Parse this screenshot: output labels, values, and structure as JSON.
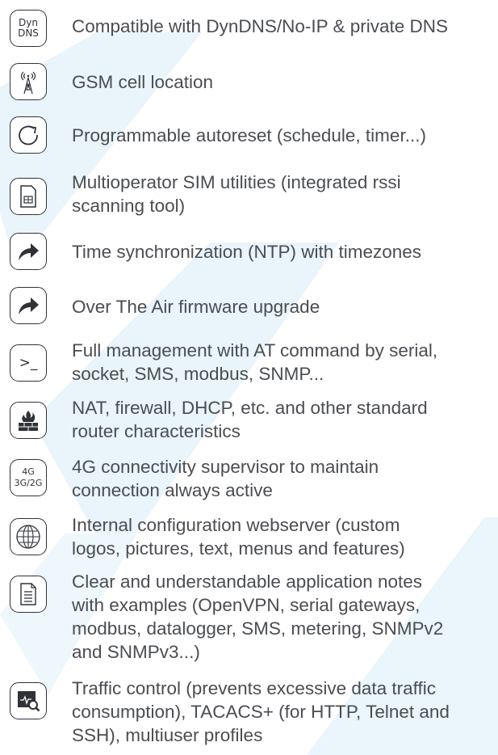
{
  "features": [
    {
      "icon": "dyndns-icon",
      "icon_text": "Dyn\nDNS",
      "text": "Compatible with DynDNS/No-IP & private DNS"
    },
    {
      "icon": "antenna-icon",
      "text": "GSM cell location"
    },
    {
      "icon": "refresh-icon",
      "text": "Programmable autoreset (schedule, timer...)"
    },
    {
      "icon": "sim-card-icon",
      "text": "Multioperator SIM utilities (integrated rssi\nscanning tool)"
    },
    {
      "icon": "share-arrow-icon",
      "text": "Time synchronization (NTP) with timezones"
    },
    {
      "icon": "share-arrow-icon",
      "text": "Over The Air firmware upgrade"
    },
    {
      "icon": "terminal-icon",
      "icon_text": ">_",
      "text": "Full management with AT command by serial,\nsocket, SMS, modbus, SNMP..."
    },
    {
      "icon": "firewall-icon",
      "text": "NAT, firewall, DHCP, etc. and other standard\nrouter characteristics"
    },
    {
      "icon": "network-generation-icon",
      "icon_text": "4G\n3G/2G",
      "text": "4G connectivity supervisor to maintain\nconnection always active"
    },
    {
      "icon": "globe-icon",
      "text": "Internal configuration webserver (custom\nlogos, pictures, text, menus and features)"
    },
    {
      "icon": "document-icon",
      "text": "Clear and understandable application notes\nwith examples (OpenVPN, serial gateways,\nmodbus, datalogger, SMS, metering, SNMPv2\nand SNMPv3...)"
    },
    {
      "icon": "traffic-monitor-icon",
      "text": "Traffic control (prevents excessive data traffic\nconsumption), TACACS+ (for HTTP, Telnet and\nSSH), multiuser profiles"
    }
  ],
  "colors": {
    "text": "#4a4d52",
    "icon_stroke": "#2f3237",
    "watermark": "#e9f4fb"
  }
}
